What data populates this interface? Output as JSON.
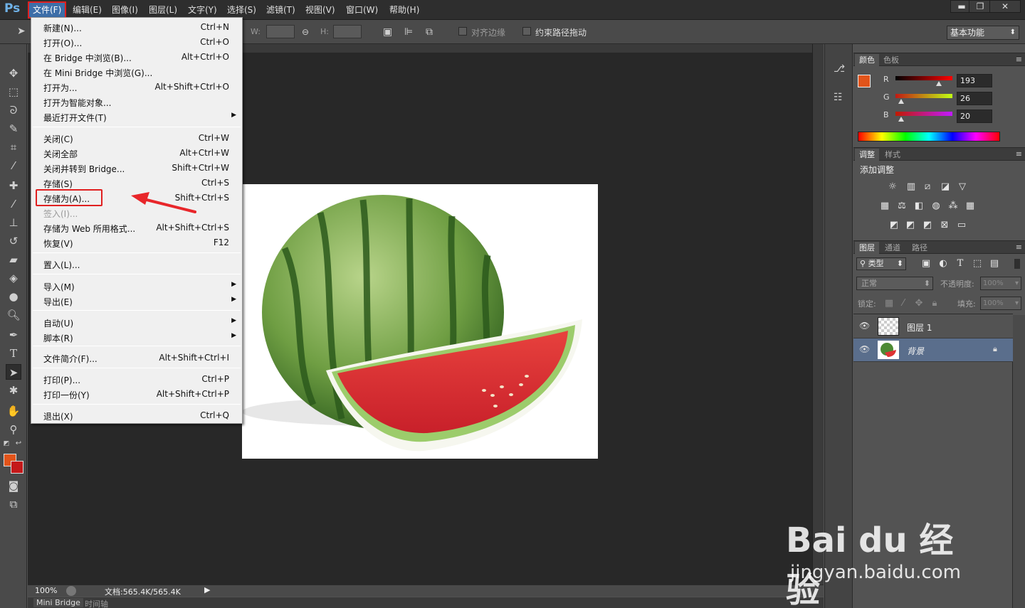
{
  "app": {
    "logo": "Ps"
  },
  "menubar": {
    "items": [
      "文件(F)",
      "编辑(E)",
      "图像(I)",
      "图层(L)",
      "文字(Y)",
      "选择(S)",
      "滤镜(T)",
      "视图(V)",
      "窗口(W)",
      "帮助(H)"
    ],
    "window_buttons": {
      "minimize": "▬",
      "restore": "❐",
      "close": "✕"
    }
  },
  "options_bar": {
    "w_label": "W:",
    "h_label": "H:",
    "align_edges": "对齐边缘",
    "constrain_path": "约束路径拖动",
    "workspace": "基本功能"
  },
  "file_menu": {
    "items": [
      {
        "label": "新建(N)...",
        "shortcut": "Ctrl+N"
      },
      {
        "label": "打开(O)...",
        "shortcut": "Ctrl+O"
      },
      {
        "label": "在 Bridge 中浏览(B)...",
        "shortcut": "Alt+Ctrl+O"
      },
      {
        "label": "在 Mini Bridge 中浏览(G)...",
        "shortcut": ""
      },
      {
        "label": "打开为...",
        "shortcut": "Alt+Shift+Ctrl+O"
      },
      {
        "label": "打开为智能对象...",
        "shortcut": ""
      },
      {
        "label": "最近打开文件(T)",
        "shortcut": ""
      },
      {
        "label": "关闭(C)",
        "shortcut": "Ctrl+W"
      },
      {
        "label": "关闭全部",
        "shortcut": "Alt+Ctrl+W"
      },
      {
        "label": "关闭并转到 Bridge...",
        "shortcut": "Shift+Ctrl+W"
      },
      {
        "label": "存储(S)",
        "shortcut": "Ctrl+S"
      },
      {
        "label": "存储为(A)...",
        "shortcut": "Shift+Ctrl+S"
      },
      {
        "label": "签入(I)...",
        "shortcut": ""
      },
      {
        "label": "存储为 Web 所用格式...",
        "shortcut": "Alt+Shift+Ctrl+S"
      },
      {
        "label": "恢复(V)",
        "shortcut": "F12"
      },
      {
        "label": "置入(L)...",
        "shortcut": ""
      },
      {
        "label": "导入(M)",
        "shortcut": ""
      },
      {
        "label": "导出(E)",
        "shortcut": ""
      },
      {
        "label": "自动(U)",
        "shortcut": ""
      },
      {
        "label": "脚本(R)",
        "shortcut": ""
      },
      {
        "label": "文件简介(F)...",
        "shortcut": "Alt+Shift+Ctrl+I"
      },
      {
        "label": "打印(P)...",
        "shortcut": "Ctrl+P"
      },
      {
        "label": "打印一份(Y)",
        "shortcut": "Alt+Shift+Ctrl+P"
      },
      {
        "label": "退出(X)",
        "shortcut": "Ctrl+Q"
      }
    ]
  },
  "color_panel": {
    "tabs": [
      "颜色",
      "色板"
    ],
    "channels": [
      {
        "label": "R",
        "value": "193"
      },
      {
        "label": "G",
        "value": "26"
      },
      {
        "label": "B",
        "value": "20"
      }
    ],
    "foreground": "#e2541a",
    "background": "#c4191a"
  },
  "adjustments_panel": {
    "tabs": [
      "调整",
      "样式"
    ],
    "heading": "添加调整"
  },
  "layers_panel": {
    "tabs": [
      "图层",
      "通道",
      "路径"
    ],
    "filter_kind": "类型",
    "blend_mode": "正常",
    "opacity_label": "不透明度:",
    "opacity_value": "100%",
    "lock_label": "锁定:",
    "fill_label": "填充:",
    "fill_value": "100%",
    "layers": [
      {
        "name": "图层 1"
      },
      {
        "name": "背景"
      }
    ]
  },
  "status_bar": {
    "zoom": "100%",
    "doc_info": "文档:565.4K/565.4K"
  },
  "bottom_tabs": [
    "Mini Bridge",
    "时间轴"
  ],
  "watermark": {
    "logo": "Bai du 经验",
    "url": "jingyan.baidu.com"
  }
}
